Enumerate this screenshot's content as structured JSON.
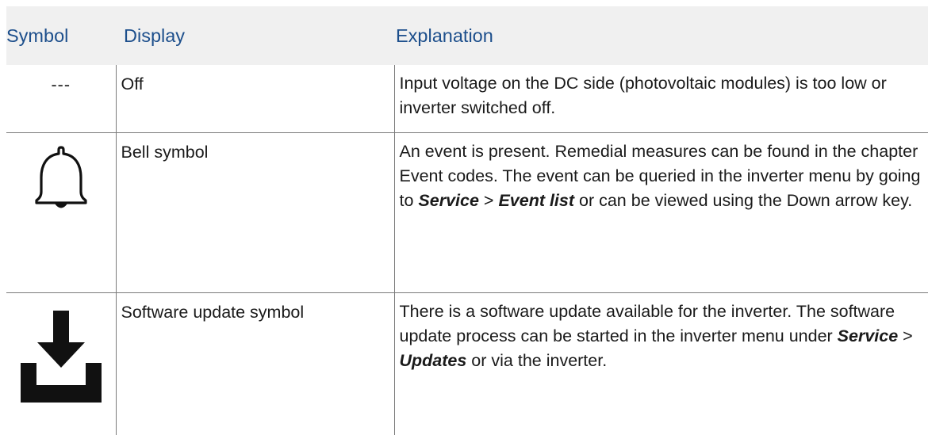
{
  "table": {
    "headers": {
      "symbol": "Symbol",
      "display": "Display",
      "explanation": "Explanation"
    },
    "rows": [
      {
        "symbol_text": "---",
        "display": "Off",
        "explanation": "Input voltage on the DC side (photovoltaic modules) is too low or inverter switched off."
      },
      {
        "symbol_icon": "bell-icon",
        "display": "Bell symbol",
        "explanation": {
          "part1": "An event is present. Remedial measures can be found in the chapter Event codes. The event can be queried in the inverter menu by going to ",
          "em1": "Service",
          "sep": " > ",
          "em2": "Event list",
          "part2": " or can be viewed using the Down arrow key."
        }
      },
      {
        "symbol_icon": "download-icon",
        "display": "Software update symbol",
        "explanation": {
          "part1": "There is a software update available for the inverter. The software update process can be started in the inverter menu under ",
          "em1": "Service",
          "sep": " > ",
          "em2": "Updates",
          "part2": " or via the inverter."
        }
      }
    ]
  }
}
